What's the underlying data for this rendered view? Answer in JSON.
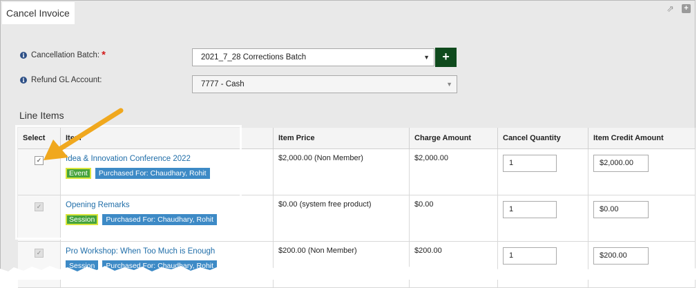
{
  "panel": {
    "title": "Cancel Invoice"
  },
  "header_icons": [
    "external-link-icon",
    "expand-plus-icon"
  ],
  "form": {
    "cancellation_batch": {
      "label": "Cancellation Batch:",
      "required_mark": "*",
      "value": "2021_7_28 Corrections Batch",
      "add_label": "+"
    },
    "refund_gl_account": {
      "label": "Refund GL Account:",
      "value": "7777 - Cash"
    }
  },
  "line_items": {
    "title": "Line Items",
    "columns": [
      "Select",
      "Item",
      "Item Price",
      "Charge Amount",
      "Cancel Quantity",
      "Item Credit Amount"
    ],
    "rows": [
      {
        "checked": "✓",
        "item": "Idea & Innovation Conference 2022",
        "type_tag": "Event",
        "purchased_for": "Purchased For: Chaudhary, Rohit",
        "price": "$2,000.00 (Non Member)",
        "charge": "$2,000.00",
        "qty": "1",
        "credit": "$2,000.00"
      },
      {
        "checked": "✓",
        "item": "Opening Remarks",
        "type_tag": "Session",
        "purchased_for": "Purchased For: Chaudhary, Rohit",
        "price": "$0.00 (system free product)",
        "charge": "$0.00",
        "qty": "1",
        "credit": "$0.00"
      },
      {
        "checked": "✓",
        "item": "Pro Workshop: When Too Much is Enough",
        "type_tag": "Session",
        "purchased_for": "Purchased For: Chaudhary, Rohit",
        "price": "$200.00 (Non Member)",
        "charge": "$200.00",
        "qty": "1",
        "credit": "$200.00"
      }
    ]
  },
  "colors": {
    "arrow": "#f0a81e",
    "event_tag": "#45a33c",
    "purchased_tag": "#3d8ac6",
    "add_button": "#0f4a1d"
  }
}
